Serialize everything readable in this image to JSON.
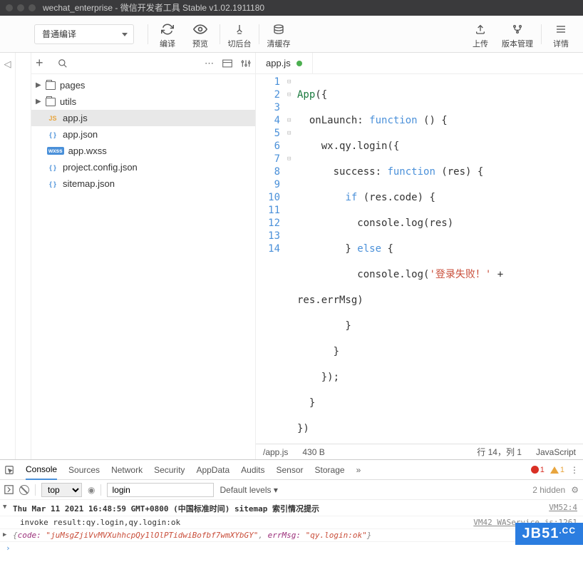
{
  "titlebar": {
    "title": "wechat_enterprise - 微信开发者工具 Stable v1.02.1911180"
  },
  "toolbar": {
    "compile_mode": "普通编译",
    "compile": "编译",
    "preview": "预览",
    "switch": "切后台",
    "clear": "清缓存",
    "upload": "上传",
    "version": "版本管理",
    "detail": "详情"
  },
  "tree": {
    "pages": "pages",
    "utils": "utils",
    "app_js": "app.js",
    "app_json": "app.json",
    "app_wxss": "app.wxss",
    "project_config": "project.config.json",
    "sitemap": "sitemap.json"
  },
  "tab": {
    "name": "app.js"
  },
  "gutter": [
    "1",
    "2",
    "3",
    "4",
    "5",
    "6",
    "7",
    "8",
    "",
    "9",
    "10",
    "11",
    "12",
    "13",
    "14"
  ],
  "code": {
    "l1a": "App",
    "l1b": "({",
    "l2a": "  onLaunch: ",
    "l2b": "function",
    "l2c": " () {",
    "l3": "    wx.qy.login({",
    "l4a": "      success: ",
    "l4b": "function",
    "l4c": " (res) {",
    "l5a": "        ",
    "l5b": "if",
    "l5c": " (res.code) {",
    "l6": "          console.log(res)",
    "l7a": "        } ",
    "l7b": "else",
    "l7c": " {",
    "l8a": "          console.log(",
    "l8b": "'登录失败！'",
    "l8c": " + ",
    "l8d": "res.errMsg)",
    "l9": "        }",
    "l10": "      }",
    "l11": "    });",
    "l12": "  }",
    "l13": "})",
    "l14": ""
  },
  "status": {
    "path": "/app.js",
    "size": "430 B",
    "pos": "行 14，列 1",
    "lang": "JavaScript"
  },
  "devtools": {
    "tabs": {
      "console": "Console",
      "sources": "Sources",
      "network": "Network",
      "security": "Security",
      "appdata": "AppData",
      "audits": "Audits",
      "sensor": "Sensor",
      "storage": "Storage"
    },
    "errors": "1",
    "warnings": "1",
    "filter": {
      "top": "top",
      "input": "login",
      "levels": "Default levels ▾",
      "hidden": "2 hidden"
    },
    "log1_time": "Thu Mar 11 2021 16:48:59 GMT+0800 (中国标准时间)",
    "log1_text": " sitemap 索引情况提示",
    "log1_src": "VM52:4",
    "log2": "invoke result:qy.login,qy.login:ok",
    "log2_src": "VM42 WAService.js:1261",
    "log3_pre": "{",
    "log3_k1": "code: ",
    "log3_v1": "\"juMsgZjiVvMVXuhhcpQy1lOlPTidwiBofbf7wmXYbGY\"",
    "log3_sep": ", ",
    "log3_k2": "errMsg: ",
    "log3_v2": "\"qy.login:ok\"",
    "log3_suf": "}",
    "prompt": "›"
  },
  "watermark": {
    "main": "JB51",
    "suf": ".CC"
  }
}
